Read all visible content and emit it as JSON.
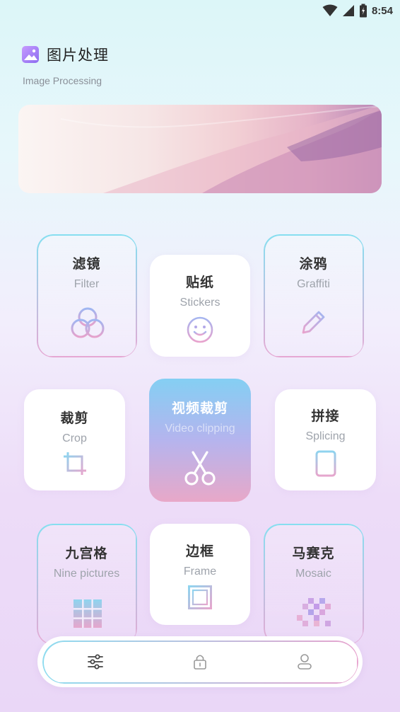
{
  "status_bar": {
    "time": "8:54",
    "icons": [
      "wifi-icon",
      "signal-icon",
      "battery-icon"
    ]
  },
  "header": {
    "title": "图片处理",
    "subtitle": "Image Processing",
    "logo_icon": "image-icon"
  },
  "tools": [
    {
      "title": "滤镜",
      "subtitle": "Filter",
      "icon": "filter-circles-icon"
    },
    {
      "title": "贴纸",
      "subtitle": "Stickers",
      "icon": "smiley-icon"
    },
    {
      "title": "涂鸦",
      "subtitle": "Graffiti",
      "icon": "pencil-icon"
    },
    {
      "title": "裁剪",
      "subtitle": "Crop",
      "icon": "crop-icon"
    },
    {
      "title": "视频裁剪",
      "subtitle": "Video clipping",
      "icon": "scissors-icon"
    },
    {
      "title": "拼接",
      "subtitle": "Splicing",
      "icon": "splice-icon"
    },
    {
      "title": "九宫格",
      "subtitle": "Nine pictures",
      "icon": "grid-icon"
    },
    {
      "title": "边框",
      "subtitle": "Frame",
      "icon": "frame-icon"
    },
    {
      "title": "马赛克",
      "subtitle": "Mosaic",
      "icon": "mosaic-icon"
    }
  ],
  "bottom_nav": {
    "items": [
      "sliders-icon",
      "lock-icon",
      "user-icon"
    ]
  },
  "colors": {
    "accent_blue": "#86dff0",
    "accent_pink": "#e6a8d3",
    "purple": "#a98cf0"
  }
}
